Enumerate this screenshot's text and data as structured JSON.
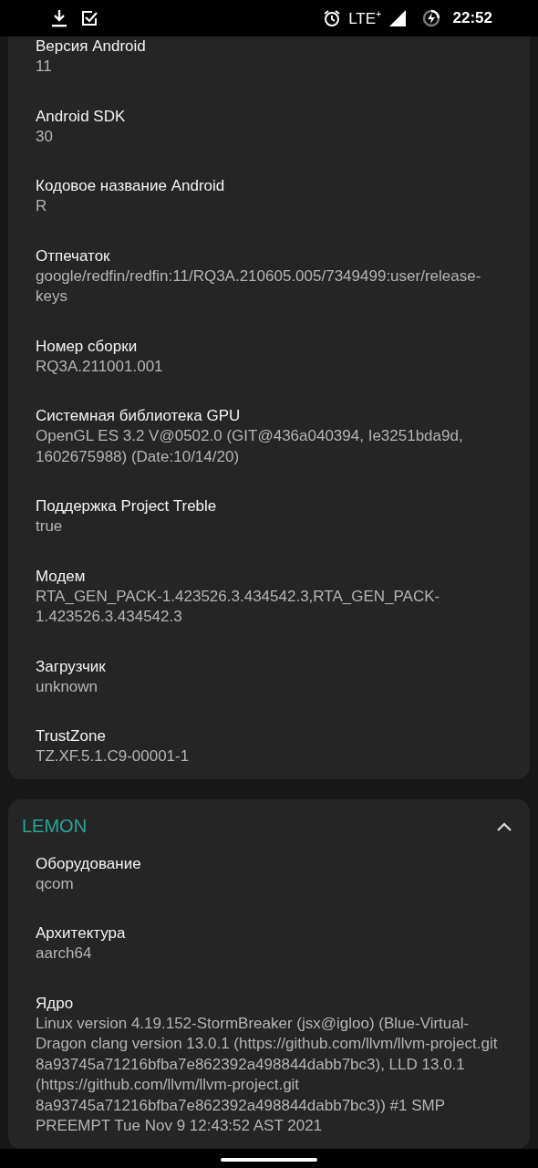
{
  "status_bar": {
    "network": "LTE$^{+}$",
    "time": "22:52"
  },
  "sections": [
    {
      "items": [
        {
          "label": "Версия Android",
          "value": "11"
        },
        {
          "label": "Android SDK",
          "value": "30"
        },
        {
          "label": "Кодовое название Android",
          "value": "R"
        },
        {
          "label": "Отпечаток",
          "value": "google/redfin/redfin:11/RQ3A.210605.005/7349499:user/release-keys"
        },
        {
          "label": "Номер сборки",
          "value": "RQ3A.211001.001"
        },
        {
          "label": "Системная библиотека GPU",
          "value": "OpenGL ES 3.2 V@0502.0 (GIT@436a040394, Ie3251bda9d, 1602675988) (Date:10/14/20)"
        },
        {
          "label": "Поддержка Project Treble",
          "value": "true"
        },
        {
          "label": "Модем",
          "value": "RTA_GEN_PACK-1.423526.3.434542.3,RTA_GEN_PACK-1.423526.3.434542.3"
        },
        {
          "label": "Загрузчик",
          "value": "unknown"
        },
        {
          "label": "TrustZone",
          "value": "TZ.XF.5.1.C9-00001-1"
        }
      ]
    },
    {
      "title": "LEMON",
      "expanded": true,
      "items": [
        {
          "label": "Оборудование",
          "value": "qcom"
        },
        {
          "label": "Архитектура",
          "value": "aarch64"
        },
        {
          "label": "Ядро",
          "value": "Linux version 4.19.152-StormBreaker (jsx@igloo) (Blue-Virtual-Dragon clang version 13.0.1 (https://github.com/llvm/llvm-project.git 8a93745a71216bfba7e862392a498844dabb7bc3), LLD 13.0.1 (https://github.com/llvm/llvm-project.git 8a93745a71216bfba7e862392a498844dabb7bc3)) #1 SMP PREEMPT Tue Nov 9 12:43:52 AST 2021"
        }
      ]
    }
  ]
}
